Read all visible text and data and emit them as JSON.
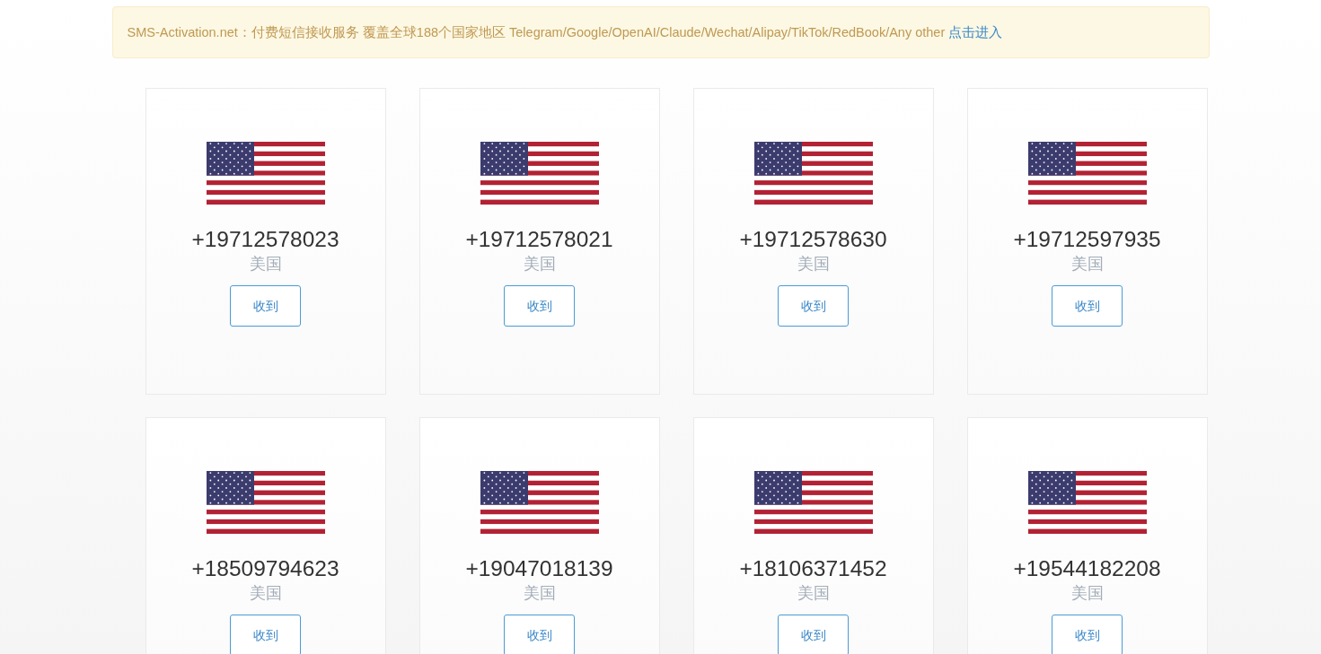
{
  "notice": {
    "text": "SMS-Activation.net：付费短信接收服务 覆盖全球188个国家地区 Telegram/Google/OpenAI/Claude/Wechat/Alipay/TikTok/RedBook/Any other",
    "link": "点击进入"
  },
  "numbers": [
    {
      "number": "+19712578023",
      "country": "美国",
      "button": "收到"
    },
    {
      "number": "+19712578021",
      "country": "美国",
      "button": "收到"
    },
    {
      "number": "+19712578630",
      "country": "美国",
      "button": "收到"
    },
    {
      "number": "+19712597935",
      "country": "美国",
      "button": "收到"
    },
    {
      "number": "+18509794623",
      "country": "美国",
      "button": "收到"
    },
    {
      "number": "+19047018139",
      "country": "美国",
      "button": "收到"
    },
    {
      "number": "+18106371452",
      "country": "美国",
      "button": "收到"
    },
    {
      "number": "+19544182208",
      "country": "美国",
      "button": "收到"
    }
  ]
}
